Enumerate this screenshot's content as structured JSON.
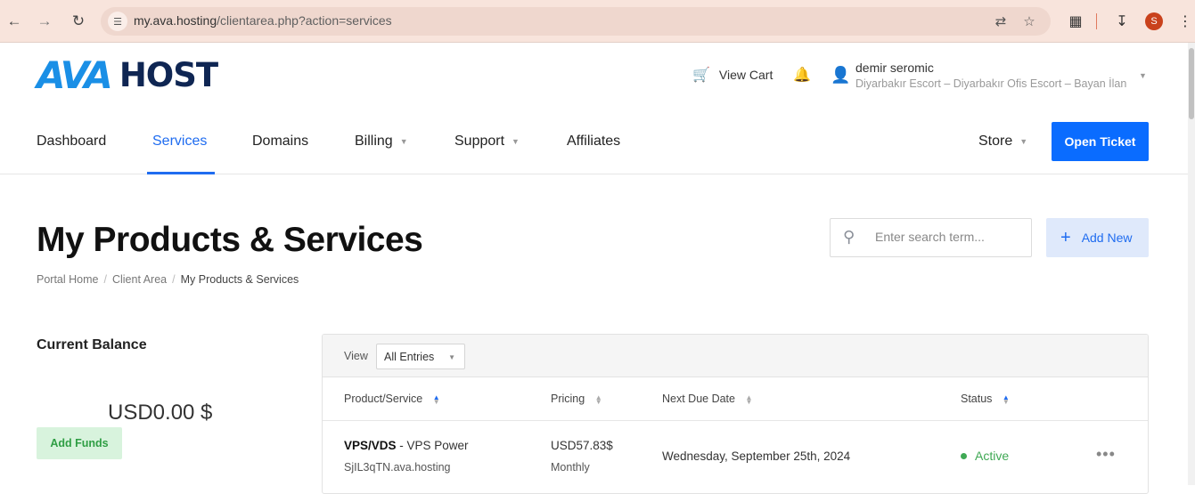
{
  "browser": {
    "url_host": "my.ava.hosting",
    "url_path": "/clientarea.php?action=services",
    "profile_initial": "S"
  },
  "header": {
    "logo_part1": "AVA",
    "logo_part2": "HOST",
    "view_cart": "View Cart",
    "user_name": "demir seromic",
    "user_company": "Diyarbakır Escort – Diyarbakır Ofis Escort – Bayan İlan"
  },
  "nav": {
    "items": [
      {
        "label": "Dashboard"
      },
      {
        "label": "Services"
      },
      {
        "label": "Domains"
      },
      {
        "label": "Billing"
      },
      {
        "label": "Support"
      },
      {
        "label": "Affiliates"
      }
    ],
    "store": "Store",
    "open_ticket": "Open Ticket"
  },
  "page": {
    "title": "My Products & Services",
    "breadcrumb": [
      "Portal Home",
      "Client Area",
      "My Products & Services"
    ],
    "search_placeholder": "Enter search term...",
    "add_new": "Add New"
  },
  "balance": {
    "title": "Current Balance",
    "value": "USD0.00 $",
    "add_funds": "Add Funds"
  },
  "table": {
    "view_label": "View",
    "view_selected": "All Entries",
    "columns": [
      "Product/Service",
      "Pricing",
      "Next Due Date",
      "Status"
    ],
    "rows": [
      {
        "product_group": "VPS/VDS",
        "product_name": " - VPS Power",
        "domain": "SjIL3qTN.ava.hosting",
        "price": "USD57.83$",
        "cycle": "Monthly",
        "next_due": "Wednesday, September 25th, 2024",
        "status": "Active",
        "more": "•••"
      }
    ]
  },
  "colors": {
    "accent": "#1f6cf0",
    "button": "#0a6cff",
    "active_status": "#40a955",
    "logo_blue": "#1a8fe6",
    "logo_navy": "#0f2653"
  }
}
